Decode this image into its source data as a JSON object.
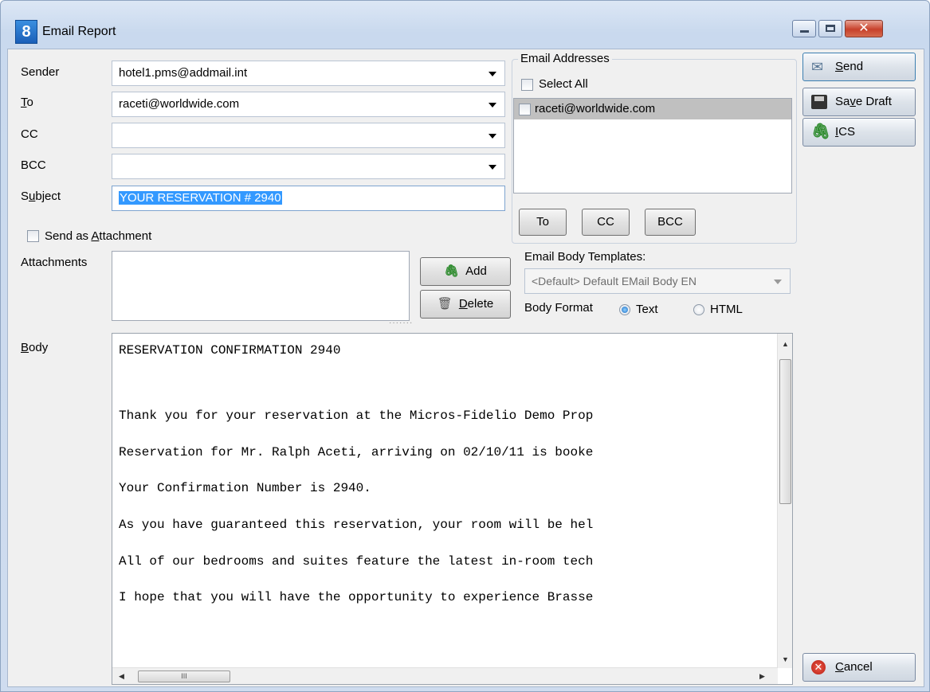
{
  "window": {
    "title": "Email Report",
    "app_icon_glyph": "8",
    "close_glyph": "✕"
  },
  "form": {
    "sender_label": "Sender",
    "sender_value": "hotel1.pms@addmail.int",
    "to_label": "To",
    "to_value": "raceti@worldwide.com",
    "cc_label": "CC",
    "cc_value": "",
    "bcc_label": "BCC",
    "bcc_value": "",
    "subject_label": "Subject",
    "subject_value": "YOUR RESERVATION # 2940",
    "send_as_attachment_label": "Send as Attachment",
    "send_as_attachment_checked": false,
    "attachments_label": "Attachments",
    "body_label": "Body"
  },
  "email_addresses": {
    "group_title": "Email Addresses",
    "select_all_label": "Select All",
    "items": [
      "raceti@worldwide.com"
    ],
    "to_button": "To",
    "cc_button": "CC",
    "bcc_button": "BCC"
  },
  "attachments": {
    "add_button": "Add",
    "delete_button": "Delete"
  },
  "templates": {
    "label": "Email Body Templates:",
    "selected": "<Default> Default EMail Body EN",
    "body_format_label": "Body Format",
    "format_text": "Text",
    "format_html": "HTML",
    "selected_format": "Text"
  },
  "body": {
    "lines": [
      "RESERVATION CONFIRMATION 2940",
      "Thank you for your reservation at the Micros-Fidelio Demo Prop",
      "Reservation for Mr. Ralph Aceti, arriving on 02/10/11 is booke",
      "Your Confirmation Number is 2940.",
      "As you have guaranteed this reservation, your room will be hel",
      "All of our bedrooms and suites feature the latest in-room tech",
      "I hope that you will have the opportunity to experience Brasse"
    ],
    "hscroll_thumb_text": "III"
  },
  "actions": {
    "send": "Send",
    "save_draft": "Save Draft",
    "ics": "ICS",
    "cancel": "Cancel"
  },
  "colors": {
    "selection": "#3399ff",
    "window_frame": "#c9d9ee"
  }
}
